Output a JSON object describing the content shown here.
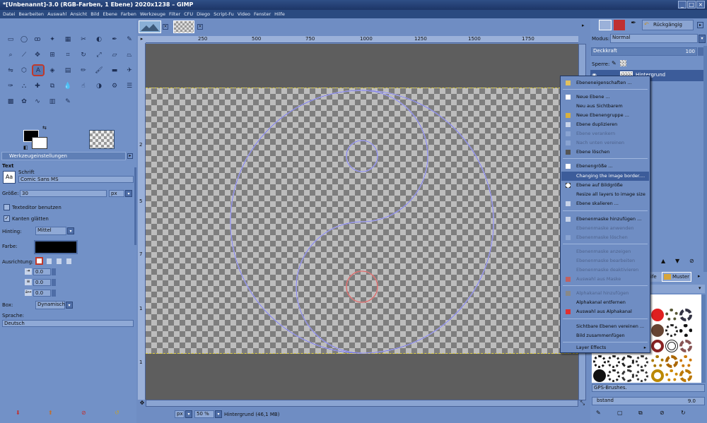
{
  "window": {
    "title": "*[Unbenannt]-3.0 (RGB-Farben, 1 Ebene) 2020x1238 – GIMP"
  },
  "menubar": [
    "Datei",
    "Bearbeiten",
    "Auswahl",
    "Ansicht",
    "Bild",
    "Ebene",
    "Farben",
    "Werkzeuge",
    "Filter",
    "CFU",
    "Diego",
    "Script-Fu",
    "Video",
    "Fenster",
    "Hilfe"
  ],
  "tool_options": {
    "tab_label": "Werkzeugeinstellungen",
    "section": "Text",
    "font_label": "Schrift",
    "font_value": "Comic Sans MS",
    "size_label": "Größe:",
    "size_value": "30",
    "size_unit": "px",
    "use_editor": "Texteditor benutzen",
    "antialias": "Kanten glätten",
    "hinting_label": "Hinting:",
    "hinting_value": "Mittel",
    "color_label": "Farbe:",
    "justify_label": "Ausrichtung:",
    "indent": "0.0",
    "line_spacing": "0.0",
    "letter_spacing": "0.0",
    "box_label": "Box:",
    "box_value": "Dynamisch",
    "language_label": "Sprache:",
    "language_value": "Deutsch"
  },
  "ruler": {
    "h": [
      "250",
      "500",
      "750",
      "1000",
      "1250",
      "1500",
      "1750"
    ],
    "v": [
      "2",
      "5",
      "7",
      "1",
      "1"
    ]
  },
  "status": {
    "unit": "px",
    "zoom": "50 %",
    "info": "Hintergrund (46,1 MB)"
  },
  "dock": {
    "undo_label": "Rückgängig",
    "mode_label": "Modus:",
    "mode_value": "Normal",
    "opacity_label": "Deckkraft",
    "opacity_value": "100",
    "lock_label": "Sperre:",
    "layer_name": "Hintergrund",
    "tab_patterns": "Muster",
    "brush_set": "GPS-Brushes.",
    "spacing_label": "bstand",
    "spacing_value": "9.0"
  },
  "context_menu": [
    {
      "label": "Ebeneneigenschaften ...",
      "enabled": true
    },
    {
      "label": "Neue Ebene ...",
      "enabled": true
    },
    {
      "label": "Neu aus Sichtbarem",
      "enabled": true
    },
    {
      "label": "Neue Ebenengruppe ...",
      "enabled": true
    },
    {
      "label": "Ebene duplizieren",
      "enabled": true
    },
    {
      "label": "Ebene verankern",
      "enabled": false
    },
    {
      "label": "Nach unten vereinen",
      "enabled": false
    },
    {
      "label": "Ebene löschen",
      "enabled": true
    },
    {
      "label": "Ebenengröße ...",
      "enabled": true
    },
    {
      "label": "Changing the image border....",
      "enabled": true,
      "highlighted": true
    },
    {
      "label": "Ebene auf Bildgröße",
      "enabled": true
    },
    {
      "label": "Resize all layers to image size",
      "enabled": true
    },
    {
      "label": "Ebene skalieren ...",
      "enabled": true
    },
    {
      "label": "Ebenenmaske hinzufügen ...",
      "enabled": true
    },
    {
      "label": "Ebenenmaske anwenden",
      "enabled": false
    },
    {
      "label": "Ebenenmaske löschen",
      "enabled": false
    },
    {
      "label": "Ebenenmaske anzeigen",
      "enabled": false
    },
    {
      "label": "Ebenenmaske bearbeiten",
      "enabled": false
    },
    {
      "label": "Ebenenmaske deaktivieren",
      "enabled": false
    },
    {
      "label": "Auswahl aus Maske",
      "enabled": false
    },
    {
      "label": "Alphakanal hinzufügen",
      "enabled": false
    },
    {
      "label": "Alphakanal entfernen",
      "enabled": true
    },
    {
      "label": "Auswahl aus Alphakanal",
      "enabled": true
    },
    {
      "label": "Sichtbare Ebenen vereinen ...",
      "enabled": true
    },
    {
      "label": "Bild zusammenfügen",
      "enabled": true
    },
    {
      "label": "Layer Effects",
      "enabled": true
    }
  ],
  "colors": {
    "accent": "#3c5c9a",
    "panel": "#7291c7",
    "canvas": "#5e5e5e",
    "highlight_tool": "#c0392b"
  }
}
